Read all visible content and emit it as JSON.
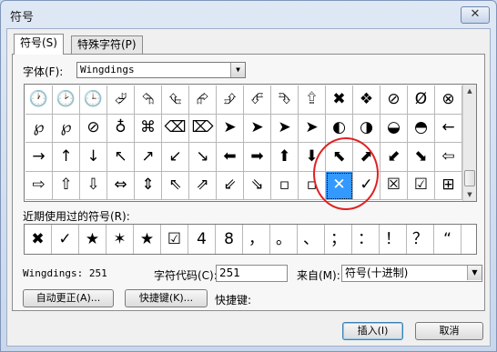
{
  "window": {
    "title": "符号",
    "close_label": "✕"
  },
  "tabs": [
    {
      "label": "符号(S)"
    },
    {
      "label": "特殊字符(P)"
    }
  ],
  "font": {
    "label": "字体(F):",
    "value": "Wingdings"
  },
  "symbol_grid": {
    "rows": [
      [
        "🕐",
        "🕑",
        "🕒",
        "⮰",
        "⮲",
        "⮴",
        "⮳",
        "⮵",
        "⮶",
        "⮷",
        "⮸",
        "✖",
        "❖",
        "⊘",
        "Ø",
        "⊗"
      ],
      [
        "℘",
        "℘",
        "⊘",
        "♁",
        "⌘",
        "⌫",
        "⌦",
        "➤",
        "➤",
        "➤",
        "➤",
        "◐",
        "◑",
        "◒",
        "◓",
        "←"
      ],
      [
        "→",
        "↑",
        "↓",
        "↖",
        "↗",
        "↙",
        "↘",
        "⬅",
        "➡",
        "⬆",
        "⬇",
        "⬉",
        "⬈",
        "⬋",
        "⬊",
        "⇦"
      ],
      [
        "⇨",
        "⇧",
        "⇩",
        "⇔",
        "⇕",
        "⇖",
        "⇗",
        "⇙",
        "⇘",
        "▫",
        "▫",
        "✕",
        "✓",
        "☒",
        "☑",
        "⊞"
      ]
    ],
    "selected": {
      "row": 3,
      "col": 11
    }
  },
  "recent": {
    "label": "近期使用过的符号(R):",
    "symbols": [
      "✖",
      "✓",
      "★",
      "✶",
      "★",
      "☑",
      "4",
      "8",
      "，",
      "。",
      "、",
      "；",
      "：",
      "！",
      "？",
      "“"
    ]
  },
  "status": {
    "font_code": "Wingdings: 251",
    "char_code_label": "字符代码(C):",
    "char_code_value": "251",
    "from_label": "来自(M):",
    "from_value": "符号(十进制)"
  },
  "buttons": {
    "autocorrect": "自动更正(A)...",
    "shortcut": "快捷键(K)...",
    "shortcut_label": "快捷键:",
    "insert": "插入(I)",
    "cancel": "取消"
  }
}
